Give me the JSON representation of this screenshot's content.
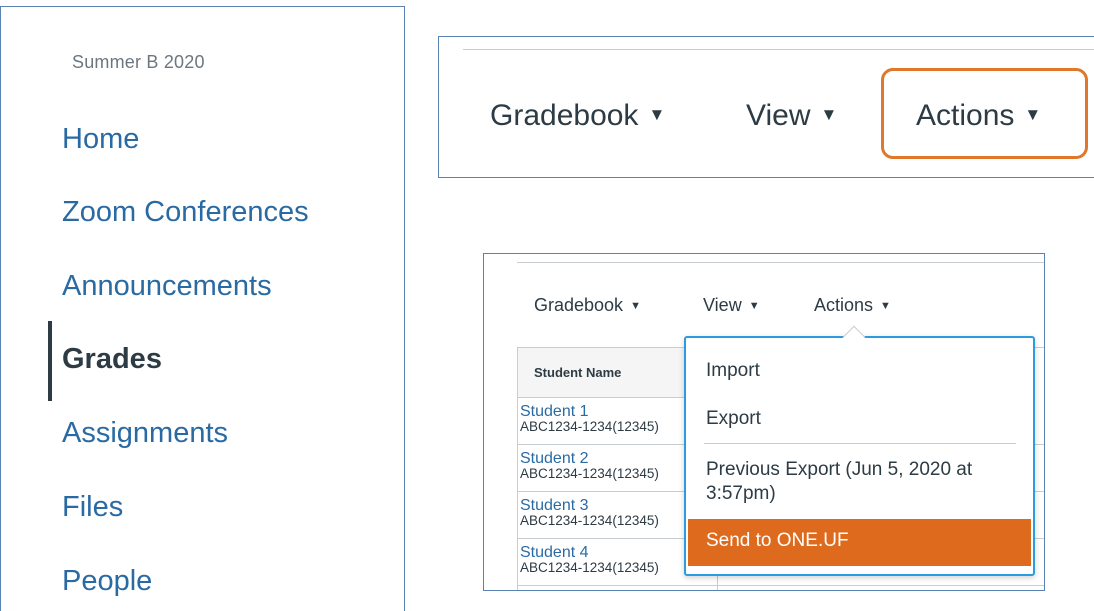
{
  "nav": {
    "term": "Summer B 2020",
    "items": [
      {
        "label": "Home"
      },
      {
        "label": "Zoom Conferences"
      },
      {
        "label": "Announcements"
      },
      {
        "label": "Grades"
      },
      {
        "label": "Assignments"
      },
      {
        "label": "Files"
      },
      {
        "label": "People"
      }
    ],
    "active": "Grades"
  },
  "header_zoom": {
    "menus": [
      "Gradebook",
      "View",
      "Actions"
    ],
    "highlighted": "Actions",
    "highlight_color": "#e0772a"
  },
  "gradebook": {
    "menus": [
      "Gradebook",
      "View",
      "Actions"
    ],
    "column_header": "Student Name",
    "students": [
      {
        "name": "Student 1",
        "id": "ABC1234-1234(12345)"
      },
      {
        "name": "Student 2",
        "id": "ABC1234-1234(12345)"
      },
      {
        "name": "Student 3",
        "id": "ABC1234-1234(12345)"
      },
      {
        "name": "Student 4",
        "id": "ABC1234-1234(12345)"
      }
    ],
    "actions_menu": {
      "items": [
        "Import",
        "Export",
        "Previous Export (Jun 5, 2020 at 3:57pm)",
        "Send to ONE.UF"
      ],
      "highlighted": "Send to ONE.UF",
      "highlight_color": "#de6b1d"
    }
  },
  "colors": {
    "link": "#2a6aa3",
    "text": "#2d3b45",
    "focus": "#2d9be0",
    "frame": "#5b82b4"
  }
}
